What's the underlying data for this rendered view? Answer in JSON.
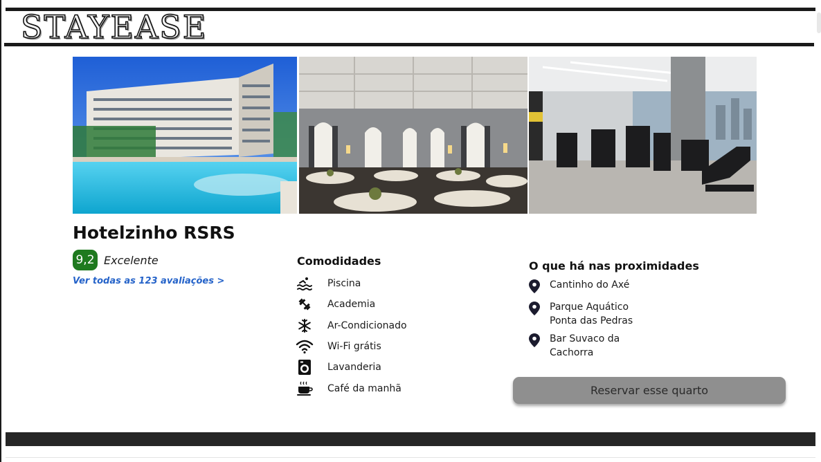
{
  "brand": {
    "logo_text": "STAYEASE"
  },
  "gallery": {
    "photos": [
      {
        "icon": "hotel-pool-photo"
      },
      {
        "icon": "banquet-hall-photo"
      },
      {
        "icon": "gym-photo"
      }
    ]
  },
  "hotel": {
    "name": "Hotelzinho RSRS",
    "rating": "9,2",
    "rating_label": "Excelente",
    "reviews_link": "Ver todas as 123 avaliações >",
    "rating_color": "#1f7a1f",
    "link_color": "#2563c9"
  },
  "amenities": {
    "title": "Comodidades",
    "items": [
      {
        "label": "Piscina",
        "icon": "swimming-icon"
      },
      {
        "label": "Academia",
        "icon": "dumbbell-icon"
      },
      {
        "label": "Ar-Condicionado",
        "icon": "snowflake-icon"
      },
      {
        "label": "Wi-Fi grátis",
        "icon": "wifi-icon"
      },
      {
        "label": "Lavanderia",
        "icon": "washing-machine-icon"
      },
      {
        "label": "Café da manhã",
        "icon": "coffee-cup-icon"
      }
    ]
  },
  "nearby": {
    "title": "O que há nas proximidades",
    "items": [
      {
        "label": "Cantinho do Axé",
        "icon": "map-pin-icon"
      },
      {
        "label": "Parque Aquático Ponta das Pedras",
        "icon": "map-pin-icon"
      },
      {
        "label": "Bar Suvaco da Cachorra",
        "icon": "map-pin-icon"
      }
    ]
  },
  "actions": {
    "reserve_label": "Reservar esse quarto",
    "reserve_color": "#8f8f8f"
  }
}
